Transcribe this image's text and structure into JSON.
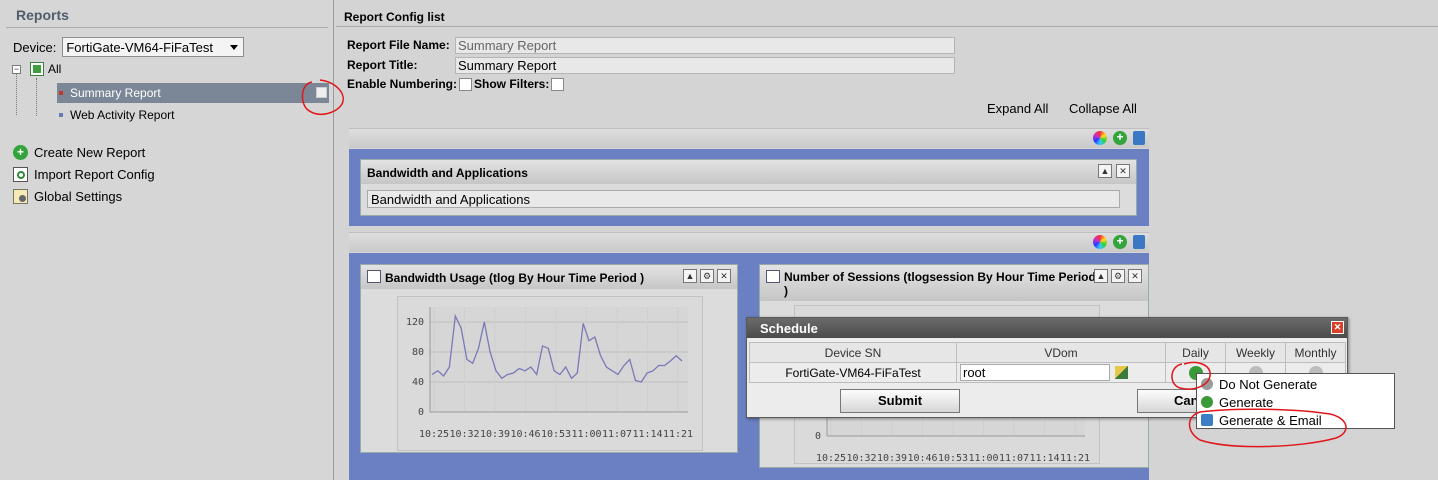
{
  "sidebar": {
    "header": "Reports",
    "device_label": "Device:",
    "device_value": "FortiGate-VM64-FiFaTest",
    "tree_root": "All",
    "tree_items": [
      {
        "label": "Summary Report",
        "selected": true
      },
      {
        "label": "Web Activity Report",
        "selected": false
      }
    ],
    "actions": [
      {
        "label": "Create New Report",
        "icon": "add-icon"
      },
      {
        "label": "Import Report Config",
        "icon": "import-icon"
      },
      {
        "label": "Global Settings",
        "icon": "settings-icon"
      }
    ]
  },
  "main": {
    "header": "Report Config list",
    "file_name_label": "Report File Name:",
    "file_name_value": "Summary Report",
    "title_label": "Report Title:",
    "title_value": "Summary Report",
    "numbering_label": "Enable Numbering:",
    "filters_label": "Show Filters:",
    "expand_all": "Expand All",
    "collapse_all": "Collapse All",
    "section1": {
      "panel_title": "Bandwidth and Applications",
      "panel_value": "Bandwidth and Applications"
    },
    "section2": {
      "chart1_title": "Bandwidth Usage (tlog By Hour Time Period )",
      "chart2_title_line1": "Number of Sessions (tlogsession By Hour Time Period",
      "chart2_title_line2": ")"
    }
  },
  "chart_data": [
    {
      "type": "line",
      "title": "Bandwidth Usage (tlog By Hour Time Period )",
      "categories": [
        "10:25",
        "10:32",
        "10:39",
        "10:46",
        "10:53",
        "11:00",
        "11:07",
        "11:14",
        "11:21"
      ],
      "y_ticks": [
        "0",
        "40",
        "80",
        "120"
      ],
      "ylim": [
        0,
        140
      ],
      "series": [
        {
          "values": [
            50,
            55,
            48,
            60,
            128,
            112,
            70,
            65,
            85,
            120,
            80,
            55,
            45,
            50,
            52,
            58,
            55,
            60,
            50,
            88,
            85,
            55,
            50,
            60,
            45,
            52,
            118,
            95,
            100,
            75,
            60,
            55,
            50,
            62,
            70,
            42,
            40,
            52,
            55,
            62,
            62,
            68,
            75,
            68
          ]
        }
      ]
    },
    {
      "type": "line",
      "title": "Number of Sessions (tlogsession By Hour Time Period )",
      "categories": [
        "10:25",
        "10:32",
        "10:39",
        "10:46",
        "10:53",
        "11:00",
        "11:07",
        "11:14",
        "11:21"
      ],
      "y_ticks": [
        "0"
      ],
      "series": []
    }
  ],
  "schedule": {
    "title": "Schedule",
    "columns": [
      "Device SN",
      "VDom",
      "Daily",
      "Weekly",
      "Monthly"
    ],
    "row": {
      "device_sn": "FortiGate-VM64-FiFaTest",
      "vdom": "root"
    },
    "submit_label": "Submit",
    "cancel_label": "Can"
  },
  "schedule_menu": [
    {
      "label": "Do Not Generate",
      "icon": "x-gray-icon",
      "color": "#9a9a9a"
    },
    {
      "label": "Generate",
      "icon": "check-green-icon",
      "color": "#3a9a3a"
    },
    {
      "label": "Generate & Email",
      "icon": "email-icon",
      "color": "#3a7fc4"
    }
  ],
  "colors": {
    "section_bg": "#6b7fc3",
    "selected_item": "#7b8796",
    "annotation_red": "#e0161b"
  }
}
